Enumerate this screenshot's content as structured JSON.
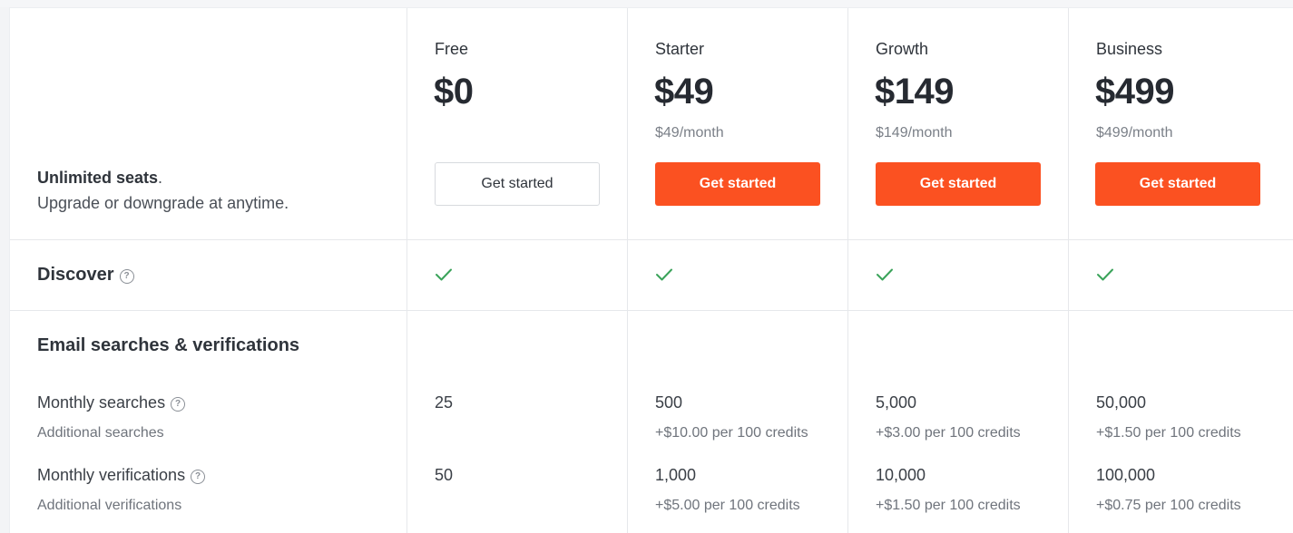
{
  "intro": {
    "bold": "Unlimited seats",
    "period": ".",
    "line2": "Upgrade or downgrade at anytime."
  },
  "plans": [
    {
      "name": "Free",
      "price": "$0",
      "sub": "",
      "cta": "Get started"
    },
    {
      "name": "Starter",
      "price": "$49",
      "sub": "$49/month",
      "cta": "Get started"
    },
    {
      "name": "Growth",
      "price": "$149",
      "sub": "$149/month",
      "cta": "Get started"
    },
    {
      "name": "Business",
      "price": "$499",
      "sub": "$499/month",
      "cta": "Get started"
    }
  ],
  "discover": {
    "label": "Discover",
    "help_icon": "?"
  },
  "email_section": {
    "title": "Email searches & verifications",
    "searches": {
      "label": "Monthly searches",
      "sublabel": "Additional searches",
      "values": [
        "25",
        "500",
        "5,000",
        "50,000"
      ],
      "extras": [
        "",
        "+$10.00 per 100 credits",
        "+$3.00 per 100 credits",
        "+$1.50 per 100 credits"
      ]
    },
    "verifications": {
      "label": "Monthly verifications",
      "sublabel": "Additional verifications",
      "values": [
        "50",
        "1,000",
        "10,000",
        "100,000"
      ],
      "extras": [
        "",
        "+$5.00 per 100 credits",
        "+$1.50 per 100 credits",
        "+$0.75 per 100 credits"
      ]
    }
  },
  "colors": {
    "accent": "#fb5121",
    "check": "#3aa35a",
    "border": "#e6e8eb"
  }
}
